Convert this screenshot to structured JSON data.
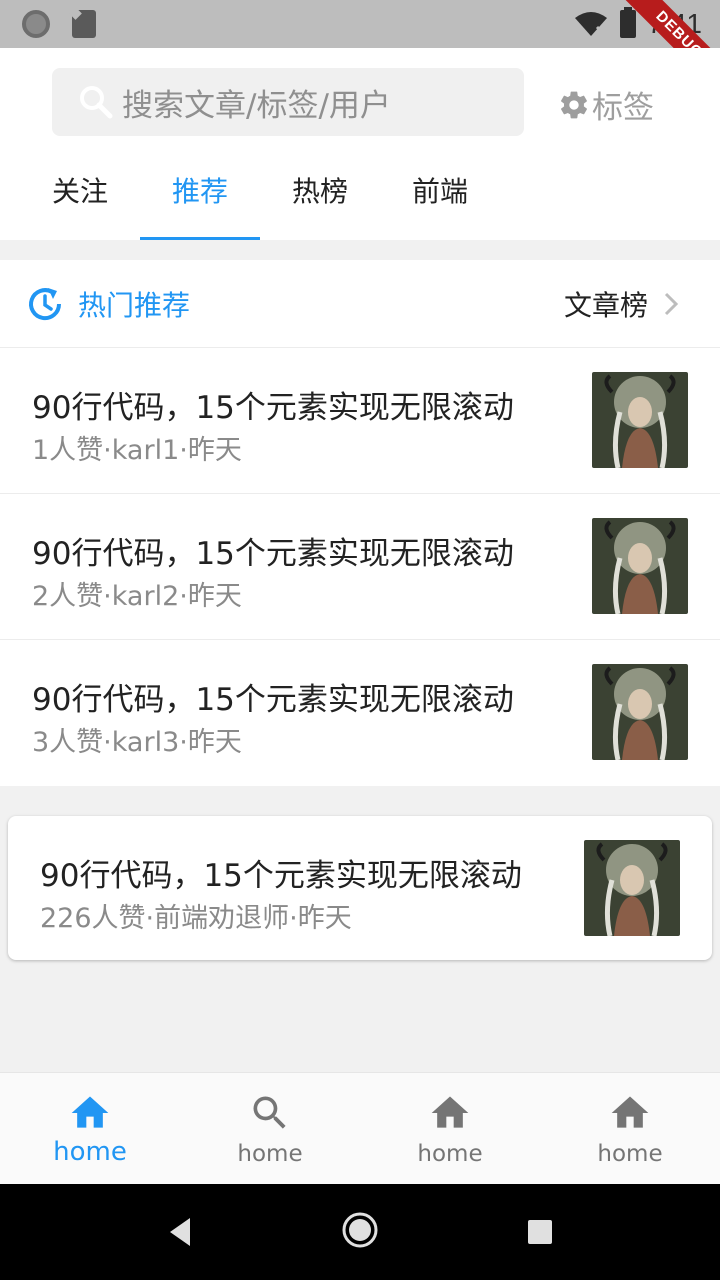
{
  "status_bar": {
    "time": "7:41",
    "debug_label": "DEBUG"
  },
  "search": {
    "placeholder": "搜索文章/标签/用户"
  },
  "tag_button": {
    "label": "标签"
  },
  "tabs": [
    {
      "label": "关注",
      "active": false
    },
    {
      "label": "推荐",
      "active": true
    },
    {
      "label": "热榜",
      "active": false
    },
    {
      "label": "前端",
      "active": false
    }
  ],
  "hot": {
    "title": "热门推荐",
    "more_label": "文章榜",
    "articles": [
      {
        "title": "90行代码，15个元素实现无限滚动",
        "meta": "1人赞·karl1·昨天"
      },
      {
        "title": "90行代码，15个元素实现无限滚动",
        "meta": "2人赞·karl2·昨天"
      },
      {
        "title": "90行代码，15个元素实现无限滚动",
        "meta": "3人赞·karl3·昨天"
      }
    ]
  },
  "card": {
    "title": "90行代码，15个元素实现无限滚动",
    "meta": "226人赞·前端劝退师·昨天"
  },
  "bottom_nav": [
    {
      "label": "home",
      "icon": "home-icon",
      "active": true
    },
    {
      "label": "home",
      "icon": "search-icon",
      "active": false
    },
    {
      "label": "home",
      "icon": "home-icon",
      "active": false
    },
    {
      "label": "home",
      "icon": "home-icon",
      "active": false
    }
  ],
  "colors": {
    "accent": "#2196f3",
    "debug_ribbon": "#b71c1c"
  }
}
